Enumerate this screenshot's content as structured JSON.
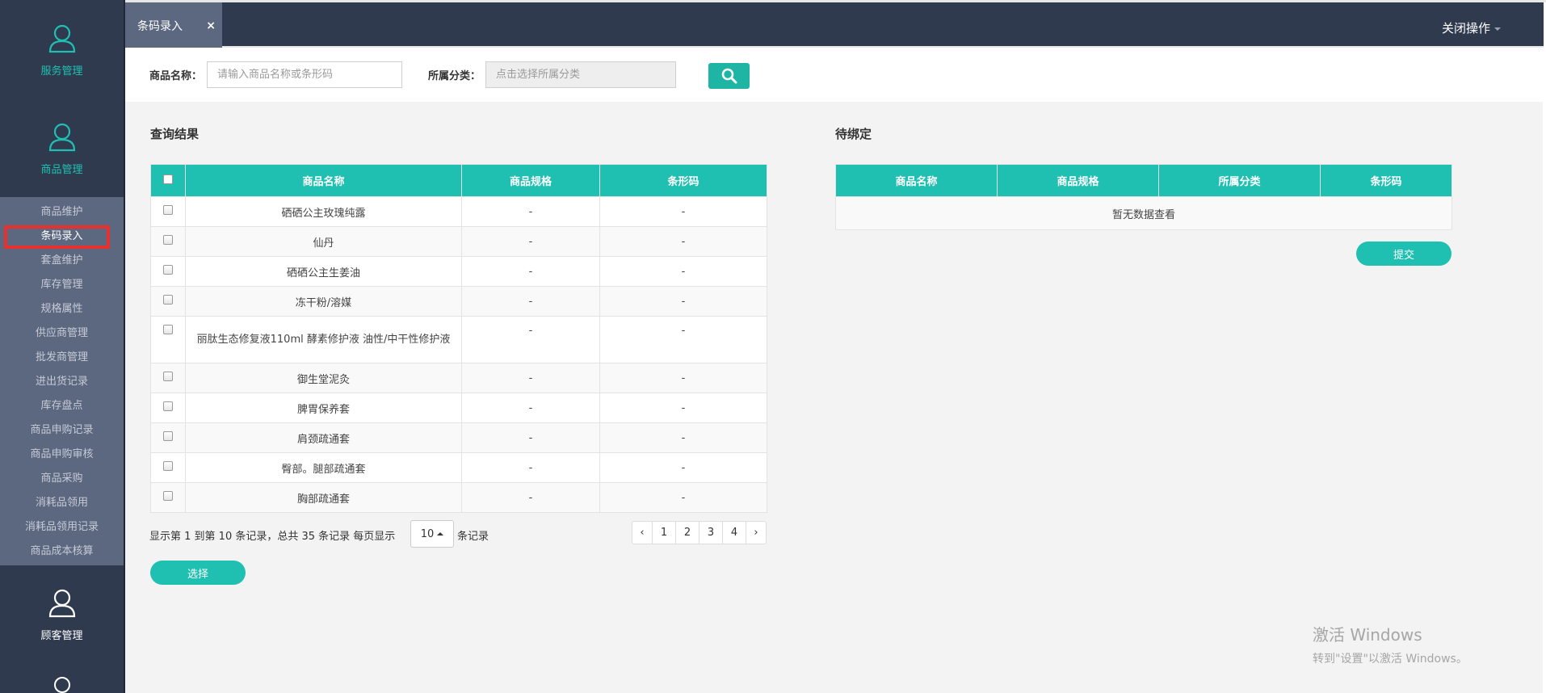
{
  "sidebar": {
    "modules": [
      {
        "label": "服务管理",
        "icon": "user-icon"
      },
      {
        "label": "商品管理",
        "icon": "user-icon"
      },
      {
        "label": "顾客管理",
        "icon": "user-icon"
      }
    ],
    "submenu": [
      "商品维护",
      "条码录入",
      "套盒维护",
      "库存管理",
      "规格属性",
      "供应商管理",
      "批发商管理",
      "进出货记录",
      "库存盘点",
      "商品申购记录",
      "商品申购审核",
      "商品采购",
      "消耗品领用",
      "消耗品领用记录",
      "商品成本核算"
    ],
    "active_submenu": "条码录入"
  },
  "header": {
    "tab_label": "条码录入",
    "tab_close": "×",
    "close_ops": "关闭操作"
  },
  "search": {
    "name_label": "商品名称：",
    "name_placeholder": "请输入商品名称或条形码",
    "category_label": "所属分类：",
    "category_placeholder": "点击选择所属分类"
  },
  "results": {
    "title": "查询结果",
    "columns": [
      "商品名称",
      "商品规格",
      "条形码"
    ],
    "rows": [
      {
        "name": "硒硒公主玫瑰纯露",
        "spec": "-",
        "barcode": "-"
      },
      {
        "name": "仙丹",
        "spec": "-",
        "barcode": "-"
      },
      {
        "name": "硒硒公主生姜油",
        "spec": "-",
        "barcode": "-"
      },
      {
        "name": "冻干粉/溶媒",
        "spec": "-",
        "barcode": "-"
      },
      {
        "name": "丽肽生态修复液110ml 酵素修护液 油性/中干性修护液",
        "spec": "-",
        "barcode": "-"
      },
      {
        "name": "御生堂泥灸",
        "spec": "-",
        "barcode": "-"
      },
      {
        "name": "脾胃保养套",
        "spec": "-",
        "barcode": "-"
      },
      {
        "name": "肩颈疏通套",
        "spec": "-",
        "barcode": "-"
      },
      {
        "name": "臀部。腿部疏通套",
        "spec": "-",
        "barcode": "-"
      },
      {
        "name": "胸部疏通套",
        "spec": "-",
        "barcode": "-"
      }
    ],
    "pagination": {
      "info": "显示第 1 到第 10 条记录，总共 35 条记录 每页显示",
      "page_size": "10",
      "suffix": "条记录",
      "prev": "‹",
      "pages": [
        "1",
        "2",
        "3",
        "4"
      ],
      "next": "›"
    },
    "select_button": "选择"
  },
  "pending": {
    "title": "待绑定",
    "columns": [
      "商品名称",
      "商品规格",
      "所属分类",
      "条形码"
    ],
    "empty_text": "暂无数据查看",
    "submit_button": "提交"
  },
  "watermark": {
    "line1": "激活 Windows",
    "line2": "转到\"设置\"以激活 Windows。"
  },
  "colors": {
    "sidebar_bg": "#2f3a4f",
    "submenu_bg": "#5c6780",
    "accent": "#1fc0b1",
    "active_outline": "#e8312f"
  }
}
